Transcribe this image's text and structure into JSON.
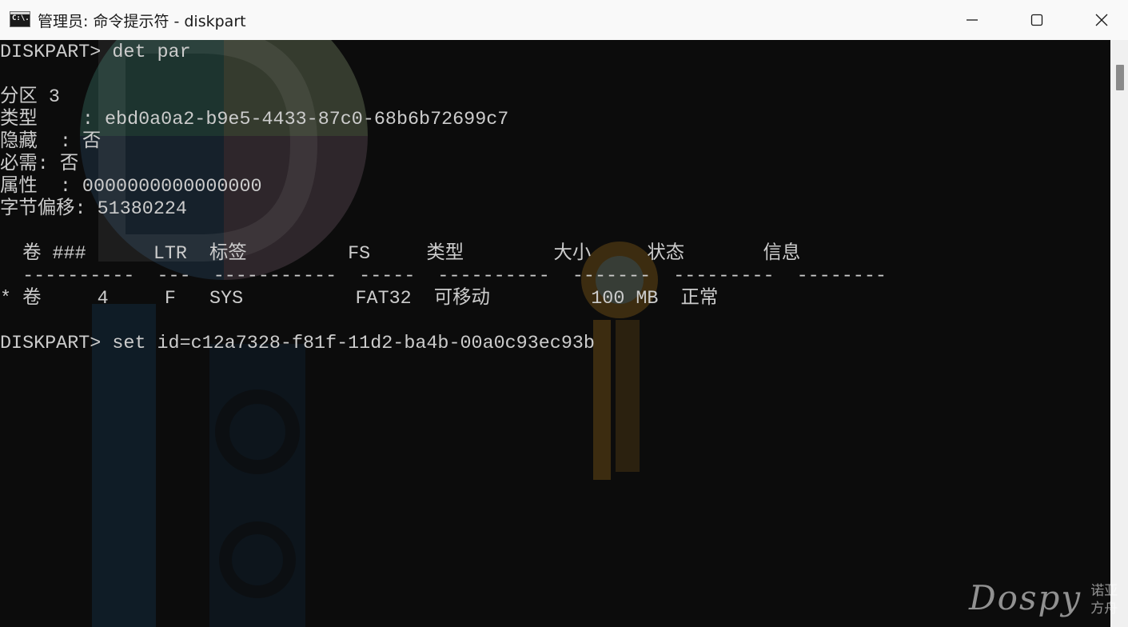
{
  "window": {
    "icon_text": "C:\\.",
    "title": "管理员: 命令提示符 - diskpart"
  },
  "console": {
    "lines": [
      "DISKPART> det par",
      "",
      "分区 3",
      "类型    : ebd0a0a2-b9e5-4433-87c0-68b6b72699c7",
      "隐藏  : 否",
      "必需: 否",
      "属性  : 0000000000000000",
      "字节偏移: 51380224",
      "",
      "  卷 ###      LTR  标签         FS     类型        大小     状态       信息",
      "  ----------  ---  -----------  -----  ----------  -------  ---------  --------",
      "* 卷     4     F   SYS          FAT32  可移动         100 MB  正常",
      "",
      "DISKPART> set id=c12a7328-f81f-11d2-ba4b-00a0c93ec93b"
    ]
  },
  "site_logo": {
    "word": "Dospy",
    "sub_line1": "诺亚",
    "sub_line2": "方舟"
  },
  "colors": {
    "console_bg": "#0c0c0c",
    "console_fg": "#cccccc",
    "titlebar_bg": "#f9f9f9",
    "scrollbar_bg": "#f0f0f0"
  }
}
